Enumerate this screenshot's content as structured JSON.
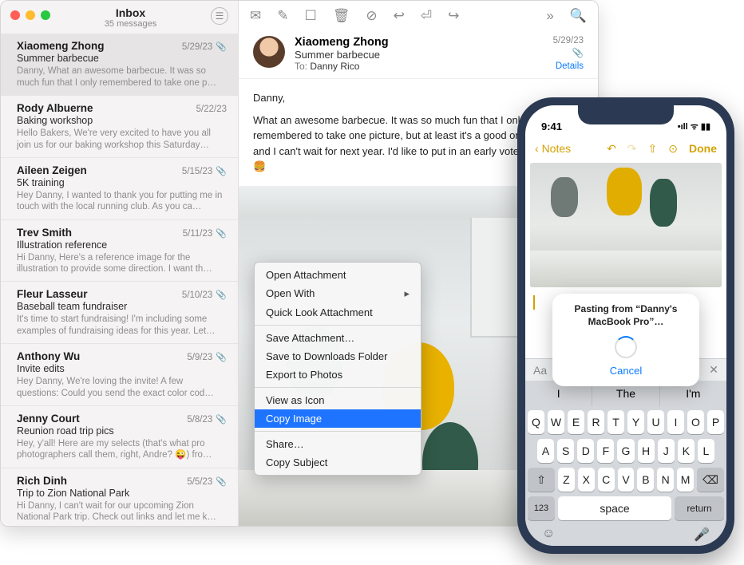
{
  "sidebar": {
    "title": "Inbox",
    "subtitle": "35 messages",
    "messages": [
      {
        "from": "Xiaomeng Zhong",
        "date": "5/29/23",
        "subject": "Summer barbecue",
        "preview": "Danny, What an awesome barbecue. It was so much fun that I only remembered to take one p…",
        "clip": true,
        "selected": true
      },
      {
        "from": "Rody Albuerne",
        "date": "5/22/23",
        "subject": "Baking workshop",
        "preview": "Hello Bakers, We're very excited to have you all join us for our baking workshop this Saturday…"
      },
      {
        "from": "Aileen Zeigen",
        "date": "5/15/23",
        "subject": "5K training",
        "preview": "Hey Danny, I wanted to thank you for putting me in touch with the local running club. As you ca…",
        "clip": true
      },
      {
        "from": "Trev Smith",
        "date": "5/11/23",
        "subject": "Illustration reference",
        "preview": "Hi Danny, Here's a reference image for the illustration to provide some direction. I want th…",
        "clip": true
      },
      {
        "from": "Fleur Lasseur",
        "date": "5/10/23",
        "subject": "Baseball team fundraiser",
        "preview": "It's time to start fundraising! I'm including some examples of fundraising ideas for this year. Let…",
        "clip": true
      },
      {
        "from": "Anthony Wu",
        "date": "5/9/23",
        "subject": "Invite edits",
        "preview": "Hey Danny, We're loving the invite! A few questions: Could you send the exact color cod…",
        "clip": true
      },
      {
        "from": "Jenny Court",
        "date": "5/8/23",
        "subject": "Reunion road trip pics",
        "preview": "Hey, y'all! Here are my selects (that's what pro photographers call them, right, Andre? 😜) fro…",
        "clip": true
      },
      {
        "from": "Rich Dinh",
        "date": "5/5/23",
        "subject": "Trip to Zion National Park",
        "preview": "Hi Danny, I can't wait for our upcoming Zion National Park trip. Check out links and let me k…",
        "clip": true
      }
    ]
  },
  "reader": {
    "from": "Xiaomeng Zhong",
    "subject": "Summer barbecue",
    "to_label": "To:",
    "to_name": "Danny Rico",
    "date": "5/29/23",
    "details": "Details",
    "greeting": "Danny,",
    "body": "What an awesome barbecue. It was so much fun that I only remembered to take one picture, but at least it's a good one! The family and I can't wait for next year. I'd like to put in an early vote for burgers. 🍔"
  },
  "context_menu": {
    "items": [
      {
        "label": "Open Attachment"
      },
      {
        "label": "Open With",
        "submenu": true
      },
      {
        "label": "Quick Look Attachment"
      },
      {
        "sep": true
      },
      {
        "label": "Save Attachment…"
      },
      {
        "label": "Save to Downloads Folder"
      },
      {
        "label": "Export to Photos"
      },
      {
        "sep": true
      },
      {
        "label": "View as Icon"
      },
      {
        "label": "Copy Image",
        "highlight": true
      },
      {
        "sep": true
      },
      {
        "label": "Share…"
      },
      {
        "label": "Copy Subject"
      }
    ]
  },
  "iphone": {
    "time": "9:41",
    "back": "Notes",
    "done": "Done",
    "paste_title": "Pasting from “Danny's MacBook Pro”…",
    "cancel": "Cancel",
    "quicktype_hint": "Aa",
    "predictions": [
      "I",
      "The",
      "I'm"
    ],
    "rows": [
      [
        "Q",
        "W",
        "E",
        "R",
        "T",
        "Y",
        "U",
        "I",
        "O",
        "P"
      ],
      [
        "A",
        "S",
        "D",
        "F",
        "G",
        "H",
        "J",
        "K",
        "L"
      ],
      [
        "Z",
        "X",
        "C",
        "V",
        "B",
        "N",
        "M"
      ]
    ],
    "sym": "123",
    "space": "space",
    "ret": "return"
  }
}
